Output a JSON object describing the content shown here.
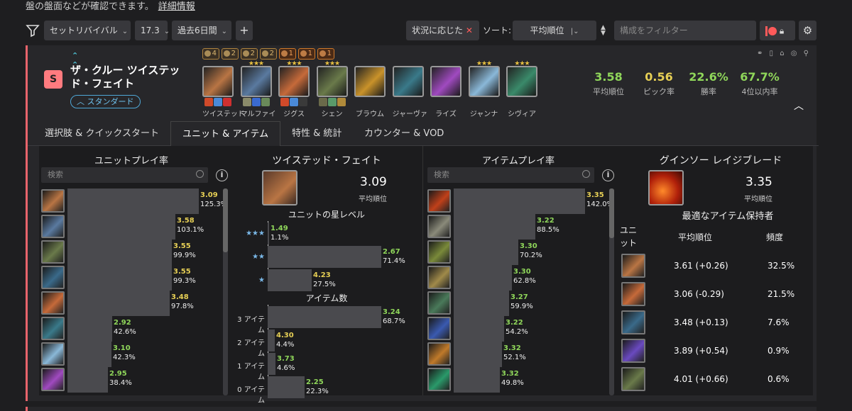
{
  "top_note": {
    "text": "盤の盤面などが確認できます。",
    "link": "詳細情報"
  },
  "toolbar": {
    "set": "セットリバイバル",
    "patch": "17.3",
    "period": "過去6日間",
    "plus": "+",
    "situational": "状況に応じた",
    "sort_label": "ソート:",
    "sort_value": "平均順位",
    "filter_placeholder": "構成をフィルター"
  },
  "comp": {
    "tier": "S",
    "title": "ザ・クルー ツイステッド・フェイト",
    "badge": "スタンダード",
    "traits": [
      {
        "count": "4",
        "color": "gold"
      },
      {
        "count": "2",
        "color": "gold"
      },
      {
        "count": "2",
        "color": "gold"
      },
      {
        "count": "2",
        "color": "gold"
      },
      {
        "count": "1",
        "color": "orange"
      },
      {
        "count": "1",
        "color": "orange"
      },
      {
        "count": "1",
        "color": "orange"
      }
    ],
    "units": [
      {
        "name": "ツイステッド",
        "stars": "",
        "color": "#b97544",
        "items": [
          "#d04a2a",
          "#4a8ad8",
          "#d03030"
        ]
      },
      {
        "name": "マルファイ",
        "stars": "★★★",
        "color": "#5a7aa0",
        "items": [
          "#8a8a6a",
          "#3a6ad0",
          "#6a8a5a"
        ]
      },
      {
        "name": "ジグス",
        "stars": "★★★",
        "color": "#c66a3a",
        "items": [
          "#d04a2a",
          "#4a8ad8",
          "#3a3a3a"
        ]
      },
      {
        "name": "シェン",
        "stars": "★★★",
        "color": "#6a7a4a",
        "items": [
          "#6a6a4a",
          "#5a9a6a",
          "#b08a3a"
        ]
      },
      {
        "name": "ブラウム",
        "stars": "",
        "color": "#c9922a",
        "items": []
      },
      {
        "name": "ジャーヴァ",
        "stars": "",
        "color": "#3a7a8a",
        "items": []
      },
      {
        "name": "ライズ",
        "stars": "",
        "color": "#a04ac0",
        "items": []
      },
      {
        "name": "ジャンナ",
        "stars": "★★★",
        "color": "#8ab8d8",
        "items": []
      },
      {
        "name": "シヴィア",
        "stars": "★★★",
        "color": "#3a8a6a",
        "items": []
      }
    ],
    "stats": [
      {
        "value": "3.58",
        "label": "平均順位",
        "color": "#8fd65a"
      },
      {
        "value": "0.56",
        "label": "ピック率",
        "color": "#e6cf55"
      },
      {
        "value": "22.6%",
        "label": "勝率",
        "color": "#8fd65a"
      },
      {
        "value": "67.7%",
        "label": "4位以内率",
        "color": "#8fd65a"
      }
    ]
  },
  "tabs": [
    "選択肢 & クイックスタート",
    "ユニット & アイテム",
    "特性 & 統計",
    "カウンター & VOD"
  ],
  "unit_play": {
    "title": "ユニットプレイ率",
    "search_placeholder": "検索",
    "info": "i",
    "rows": [
      {
        "avg": "3.09",
        "pct": "125.3%",
        "rate": 1.253,
        "color": "#b97544",
        "avg_color": "#e6cf55"
      },
      {
        "avg": "3.58",
        "pct": "103.1%",
        "rate": 1.031,
        "color": "#5a7aa0",
        "avg_color": "#e6cf55"
      },
      {
        "avg": "3.55",
        "pct": "99.9%",
        "rate": 0.999,
        "color": "#6a7a4a",
        "avg_color": "#e6cf55"
      },
      {
        "avg": "3.55",
        "pct": "99.3%",
        "rate": 0.993,
        "color": "#3a6a8a",
        "avg_color": "#e6cf55"
      },
      {
        "avg": "3.48",
        "pct": "97.8%",
        "rate": 0.978,
        "color": "#c66a3a",
        "avg_color": "#e6cf55"
      },
      {
        "avg": "2.92",
        "pct": "42.6%",
        "rate": 0.426,
        "color": "#3a7a8a",
        "avg_color": "#8fd65a"
      },
      {
        "avg": "3.10",
        "pct": "42.3%",
        "rate": 0.423,
        "color": "#8ab8d8",
        "avg_color": "#8fd65a"
      },
      {
        "avg": "2.95",
        "pct": "38.4%",
        "rate": 0.384,
        "color": "#a04ac0",
        "avg_color": "#8fd65a"
      }
    ]
  },
  "unit_detail": {
    "name": "ツイステッド・フェイト",
    "avg": "3.09",
    "avg_label": "平均順位",
    "star_title": "ユニットの星レベル",
    "stars": [
      {
        "label": "★★★",
        "avg": "1.49",
        "pct": "1.1%",
        "rate": 0.011
      },
      {
        "label": "★★",
        "avg": "2.67",
        "pct": "71.4%",
        "rate": 0.714
      },
      {
        "label": "★",
        "avg": "4.23",
        "pct": "27.5%",
        "rate": 0.275
      }
    ],
    "item_count_title": "アイテム数",
    "item_counts": [
      {
        "label": "3 アイテム",
        "avg": "3.24",
        "pct": "68.7%",
        "rate": 0.687
      },
      {
        "label": "2 アイテム",
        "avg": "4.30",
        "pct": "4.4%",
        "rate": 0.044
      },
      {
        "label": "1 アイテム",
        "avg": "3.73",
        "pct": "4.6%",
        "rate": 0.046
      },
      {
        "label": "0 アイテム",
        "avg": "2.25",
        "pct": "22.3%",
        "rate": 0.223
      }
    ]
  },
  "item_play": {
    "title": "アイテムプレイ率",
    "search_placeholder": "検索",
    "info": "i",
    "rows": [
      {
        "avg": "3.35",
        "pct": "142.0%",
        "rate": 1.42,
        "color": "#c0401a"
      },
      {
        "avg": "3.22",
        "pct": "88.5%",
        "rate": 0.885,
        "color": "#8a8a7a"
      },
      {
        "avg": "3.30",
        "pct": "70.2%",
        "rate": 0.702,
        "color": "#7a8a3a"
      },
      {
        "avg": "3.30",
        "pct": "62.8%",
        "rate": 0.628,
        "color": "#a08a4a"
      },
      {
        "avg": "3.27",
        "pct": "59.9%",
        "rate": 0.599,
        "color": "#4a7a5a"
      },
      {
        "avg": "3.22",
        "pct": "54.2%",
        "rate": 0.542,
        "color": "#3a5ab0"
      },
      {
        "avg": "3.32",
        "pct": "52.1%",
        "rate": 0.521,
        "color": "#c07a2a"
      },
      {
        "avg": "3.32",
        "pct": "49.8%",
        "rate": 0.498,
        "color": "#2a9a6a"
      }
    ]
  },
  "item_detail": {
    "name": "グインソー レイジブレード",
    "avg": "3.35",
    "avg_label": "平均順位",
    "holders_title": "最適なアイテム保持者",
    "col_unit": "ユニット",
    "col_avg": "平均順位",
    "col_freq": "頻度",
    "holders": [
      {
        "avg": "3.61 (+0.26)",
        "freq": "32.5%",
        "color": "#b97544"
      },
      {
        "avg": "3.06 (-0.29)",
        "freq": "21.5%",
        "color": "#c66a3a"
      },
      {
        "avg": "3.48 (+0.13)",
        "freq": "7.6%",
        "color": "#3a6a8a"
      },
      {
        "avg": "3.89 (+0.54)",
        "freq": "0.9%",
        "color": "#6a4ac0"
      },
      {
        "avg": "4.01 (+0.66)",
        "freq": "0.6%",
        "color": "#6a7a4a"
      }
    ]
  }
}
